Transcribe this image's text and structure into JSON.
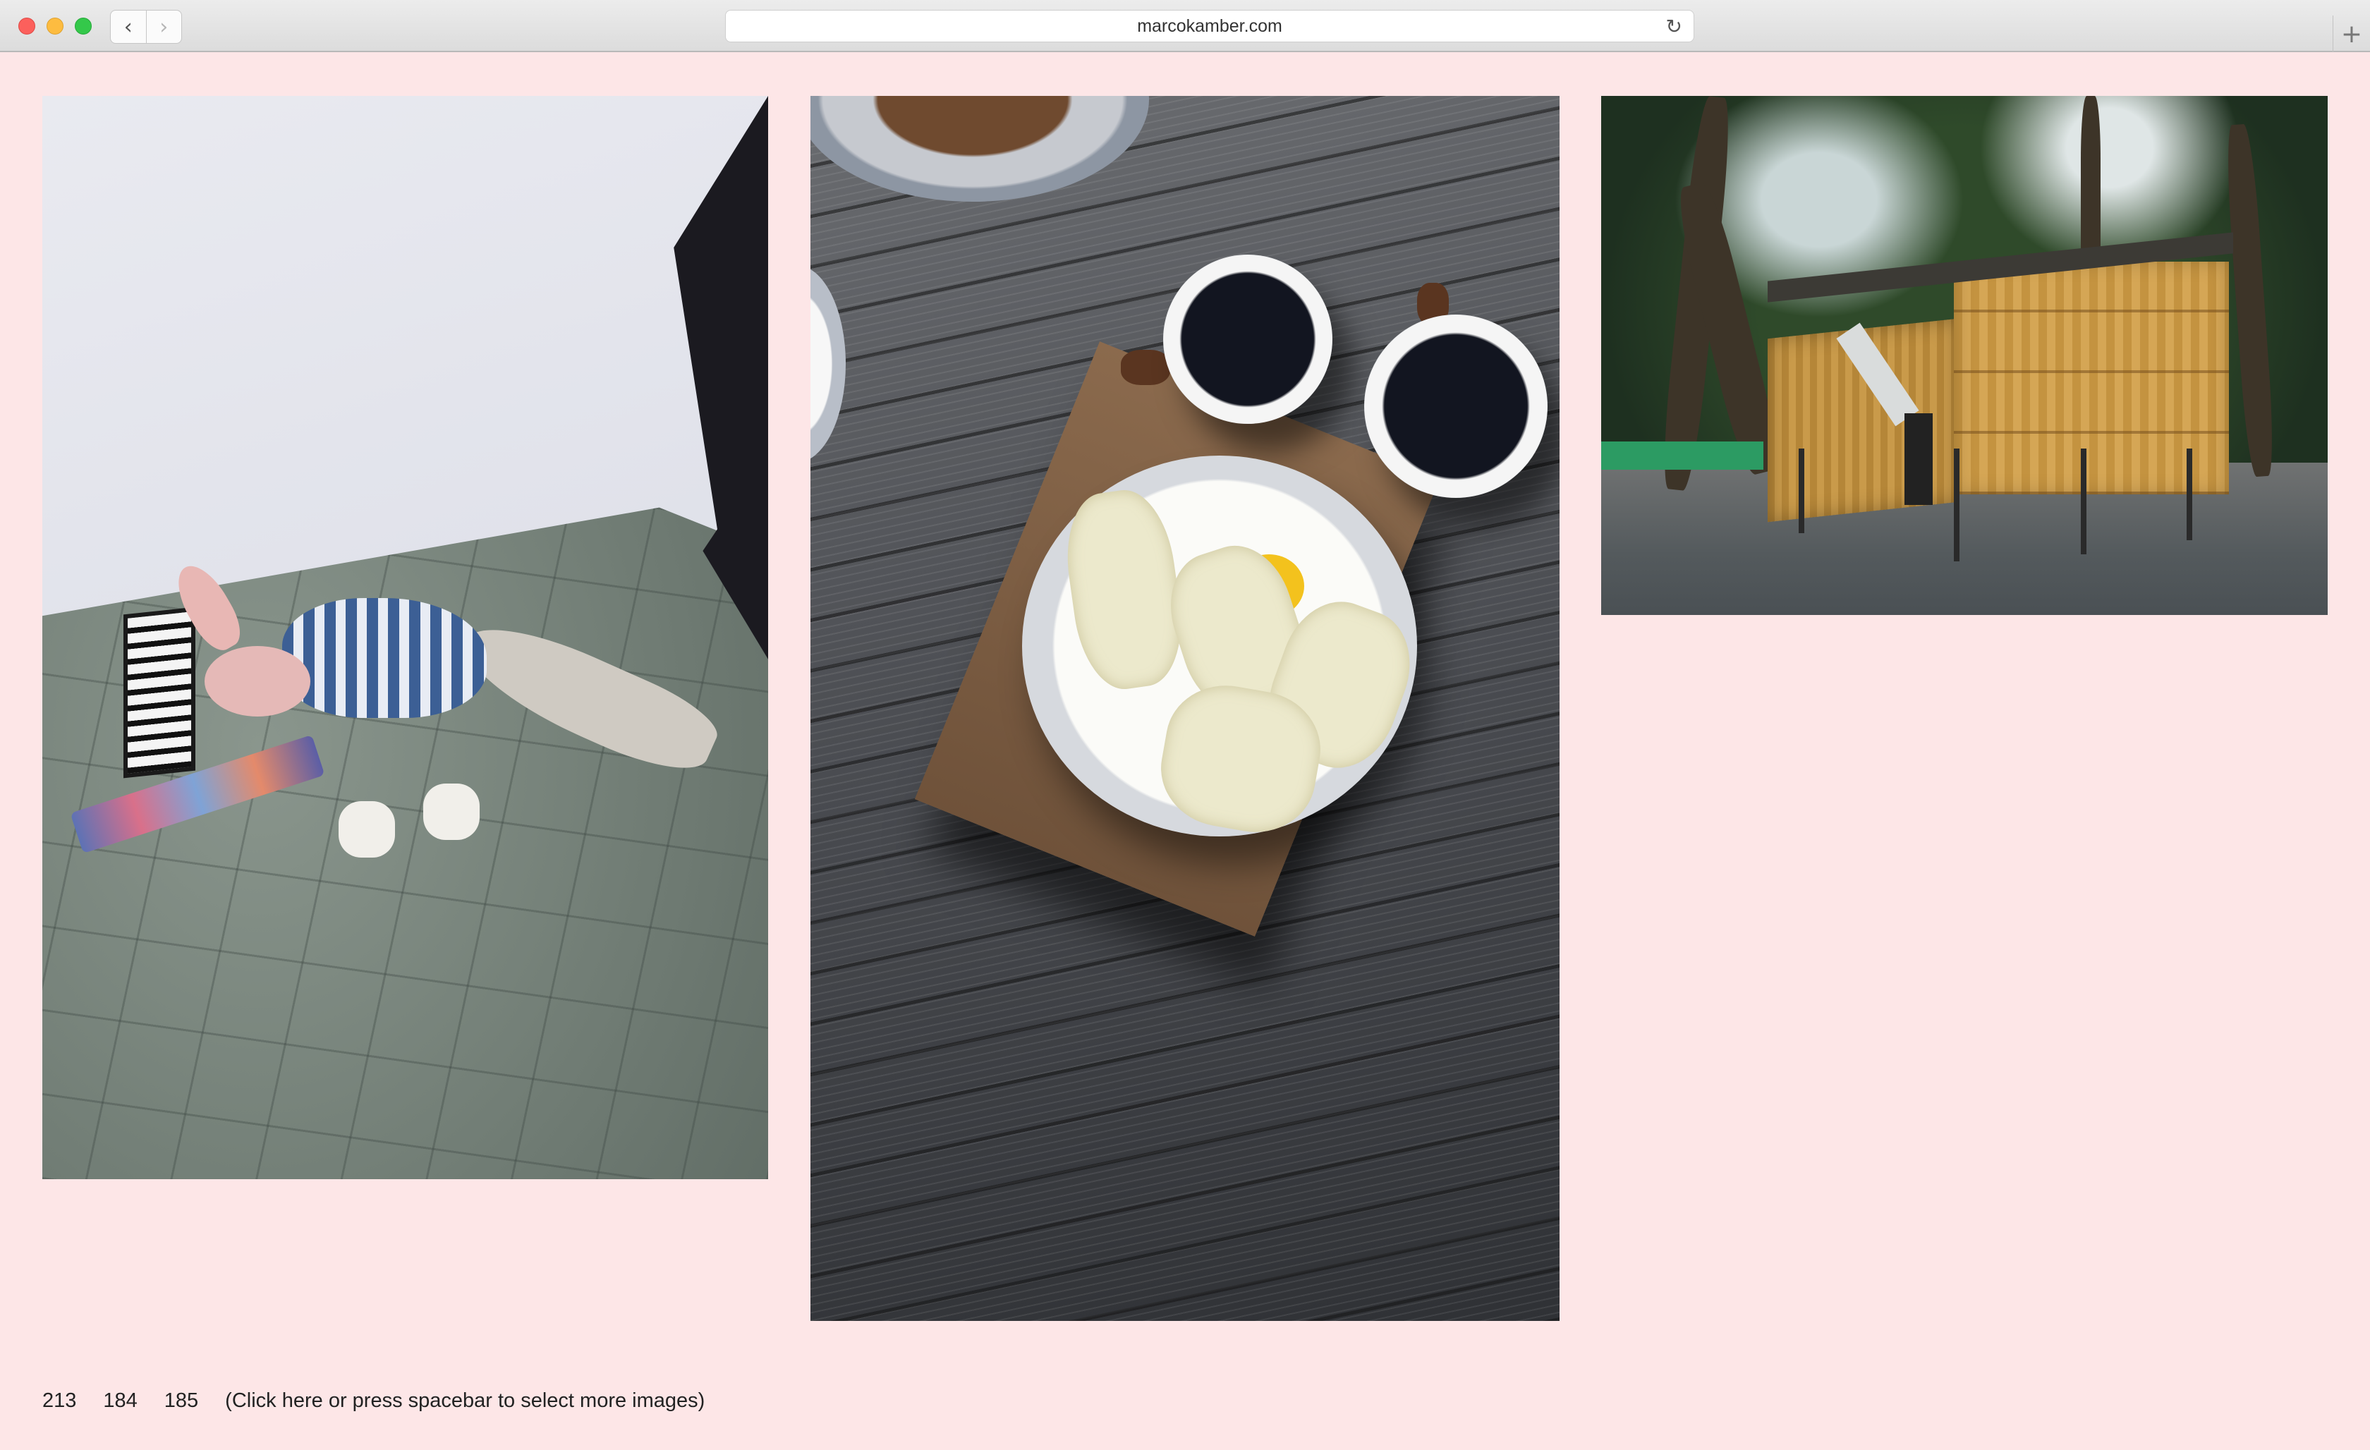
{
  "browser": {
    "url": "marcokamber.com",
    "back_icon": "chevron-left-icon",
    "forward_icon": "chevron-right-icon",
    "reload_icon": "reload-icon",
    "new_tab_icon": "plus-icon",
    "traffic_lights": [
      "#fc605c",
      "#fdbc40",
      "#34c84a"
    ]
  },
  "page": {
    "background_color": "#fde6e7",
    "images": [
      {
        "number": "213",
        "description_icon": "photo-plush-toy-on-tiled-floor"
      },
      {
        "number": "184",
        "description_icon": "photo-breakfast-on-wooden-table"
      },
      {
        "number": "185",
        "description_icon": "photo-wooden-hut-in-forest"
      }
    ],
    "footer": {
      "numbers": [
        "213",
        "184",
        "185"
      ],
      "hint": "(Click here or press spacebar to select more images)"
    }
  }
}
